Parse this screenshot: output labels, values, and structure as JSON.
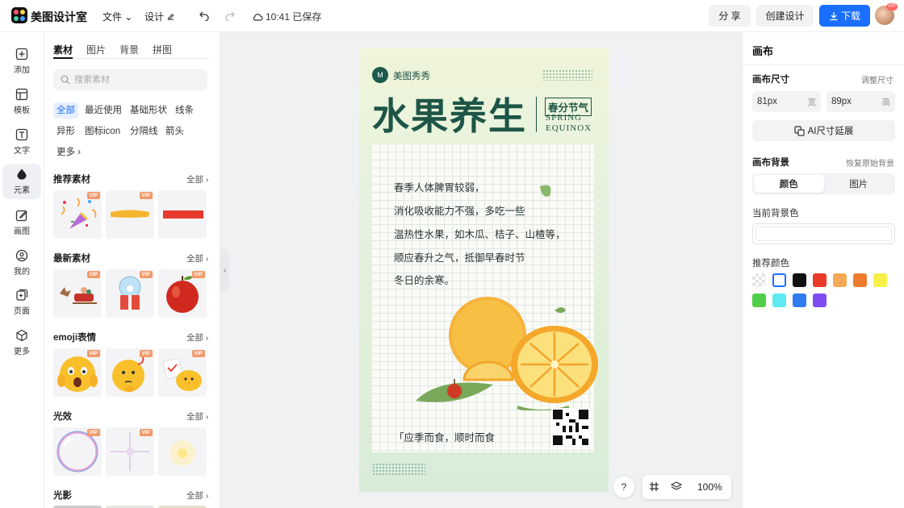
{
  "app": {
    "title": "美图设计室"
  },
  "topbar": {
    "file_menu": "文件",
    "design_menu": "设计",
    "save_status": "10:41 已保存",
    "share_label": "分 享",
    "create_label": "创建设计",
    "download_label": "下载",
    "vip_badge": "VIP"
  },
  "rail": [
    {
      "label": "添加",
      "icon": "plus-icon"
    },
    {
      "label": "模板",
      "icon": "template-icon"
    },
    {
      "label": "文字",
      "icon": "text-icon"
    },
    {
      "label": "元素",
      "icon": "element-icon",
      "active": true
    },
    {
      "label": "画图",
      "icon": "draw-icon"
    },
    {
      "label": "我的",
      "icon": "user-icon"
    },
    {
      "label": "页面",
      "icon": "page-icon"
    },
    {
      "label": "更多",
      "icon": "cube-icon"
    }
  ],
  "panel": {
    "tabs": [
      "素材",
      "图片",
      "背景",
      "拼图"
    ],
    "active_tab": "素材",
    "search_placeholder": "搜索素材",
    "chips": [
      "全部",
      "最近使用",
      "基础形状",
      "线条",
      "异形",
      "图标icon",
      "分隔线",
      "箭头",
      "更多"
    ],
    "active_chip": "全部",
    "all_label": "全部",
    "vip": "VIP",
    "sections": [
      {
        "title": "推荐素材"
      },
      {
        "title": "最新素材"
      },
      {
        "title": "emoji表情"
      },
      {
        "title": "光效"
      },
      {
        "title": "光影"
      }
    ]
  },
  "poster": {
    "brand": "美图秀秀",
    "title": "水果养生",
    "seal": "春分节气",
    "spring_line1": "SPRING",
    "spring_line2": "EQUINOX",
    "poem": [
      "春季人体脾胃较弱，",
      "消化吸收能力不强，多吃一些",
      "温热性水果，如木瓜、桔子、山楂等，",
      "顺应春升之气，抵御早春时节",
      "冬日的余寒。"
    ],
    "slogan": "「应季而食，顺时而食"
  },
  "canvas_controls": {
    "help": "?",
    "zoom": "100%"
  },
  "right_panel": {
    "title": "画布",
    "size_label": "画布尺寸",
    "adjust_size": "调整尺寸",
    "width_value": "81px",
    "width_unit": "宽",
    "height_value": "89px",
    "height_unit": "高",
    "ai_extend": "AI尺寸延展",
    "bg_label": "画布背景",
    "restore_bg": "恢复原始背景",
    "seg_color": "颜色",
    "seg_image": "图片",
    "current_bg": "当前背景色",
    "current_bg_value": "",
    "recommended": "推荐颜色",
    "swatches": [
      "transparent",
      "#ffffff",
      "#111111",
      "#ea3a2a",
      "#f5a856",
      "#ef7b2c",
      "#f8f04a",
      "#52cf4a",
      "#5eeaf0",
      "#2f7bf0",
      "#7e4ef2"
    ]
  }
}
